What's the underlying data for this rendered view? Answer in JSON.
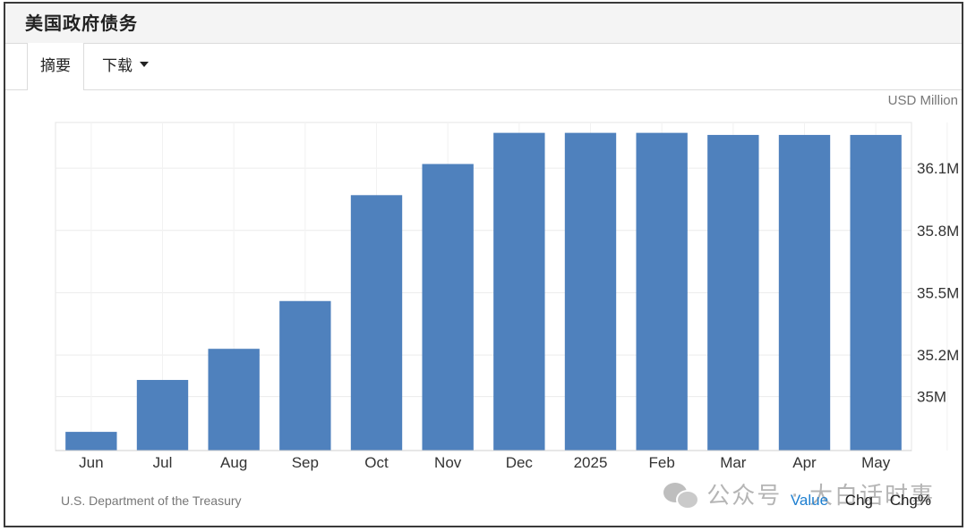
{
  "header": {
    "title": "美国政府债务"
  },
  "tabs": {
    "summary": "摘要",
    "download": "下载"
  },
  "unit_label": "USD Million",
  "source": "U.S. Department of the Treasury",
  "controls": {
    "value": "Value",
    "chg": "Chg",
    "chg_pct": "Chg%"
  },
  "watermark": "公众号 · 大白话时事",
  "colors": {
    "bar": "#4f81bd",
    "grid": "#ececec",
    "link": "#1e7fd0"
  },
  "chart_data": {
    "type": "bar",
    "categories": [
      "Jun",
      "Jul",
      "Aug",
      "Sep",
      "Oct",
      "Nov",
      "Dec",
      "2025",
      "Feb",
      "Mar",
      "Apr",
      "May"
    ],
    "values": [
      34.83,
      35.08,
      35.23,
      35.46,
      35.97,
      36.12,
      36.27,
      36.27,
      36.27,
      36.26,
      36.26,
      36.26
    ],
    "ytick_values": [
      35.0,
      35.2,
      35.5,
      35.8,
      36.1
    ],
    "ytick_labels": [
      "35M",
      "35.2M",
      "35.5M",
      "35.8M",
      "36.1M"
    ],
    "ylim": [
      34.74,
      36.32
    ],
    "ylabel": "USD Million",
    "y_axis_position": "right",
    "grid": true
  }
}
